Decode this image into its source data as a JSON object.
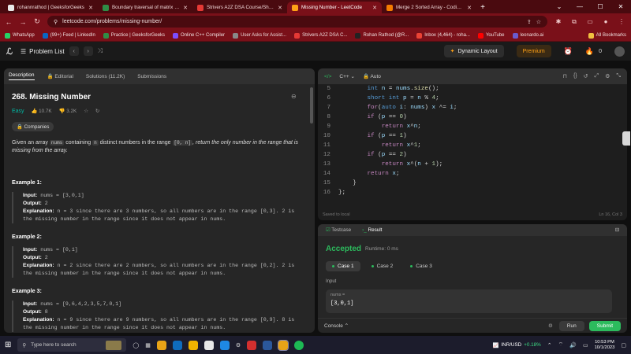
{
  "browser": {
    "tabs": [
      {
        "title": "rohannrathod | GeeksforGeeks",
        "favicon_color": "#e8e8e8",
        "active": false
      },
      {
        "title": "Boundary traversal of matrix | Pr",
        "favicon_color": "#2f8d46",
        "active": false
      },
      {
        "title": "Strivers A2Z DSA Course/Sheet",
        "favicon_color": "#e53935",
        "active": false
      },
      {
        "title": "Missing Number - LeetCode",
        "favicon_color": "#ffa116",
        "active": true
      },
      {
        "title": "Merge 2 Sorted Array - Coding N",
        "favicon_color": "#f57c00",
        "active": false
      }
    ],
    "new_tab": "+",
    "url": "leetcode.com/problems/missing-number/",
    "bookmarks": [
      {
        "label": "WhatsApp",
        "color": "#25d366"
      },
      {
        "label": "(99+) Feed | LinkedIn",
        "color": "#0a66c2"
      },
      {
        "label": "Practice | GeeksforGeeks",
        "color": "#2f8d46"
      },
      {
        "label": "Online C++ Compiler",
        "color": "#7c4dff"
      },
      {
        "label": "User Asks for Assist...",
        "color": "#888888"
      },
      {
        "label": "Strivers A2Z DSA C...",
        "color": "#e53935"
      },
      {
        "label": "Rohan Rathod (@R...",
        "color": "#222222"
      },
      {
        "label": "Inbox (4,464) - roha...",
        "color": "#ea4335"
      },
      {
        "label": "YouTube",
        "color": "#ff0000"
      },
      {
        "label": "leonardo.ai",
        "color": "#6a5acd"
      }
    ],
    "all_bookmarks": "All Bookmarks"
  },
  "lc_nav": {
    "problem_list": "Problem List",
    "dynamic_layout": "Dynamic Layout",
    "premium": "Premium",
    "streak": "0"
  },
  "left_panel": {
    "tabs": [
      "Description",
      "Editorial",
      "Solutions (11.2K)",
      "Submissions"
    ],
    "title": "268. Missing Number",
    "difficulty": "Easy",
    "likes": "10.7K",
    "dislikes": "3.2K",
    "companies": "Companies",
    "desc_1": "Given an array",
    "desc_code_1": "nums",
    "desc_2": "containing",
    "desc_code_2": "n",
    "desc_3": "distinct numbers in the range",
    "desc_code_3": "[0, n]",
    "desc_4": ", return the only number in the range that is missing from the array.",
    "examples": [
      {
        "heading": "Example 1:",
        "input_label": "Input:",
        "input": " nums = [3,0,1]",
        "output_label": "Output:",
        "output": " 2",
        "expl_label": "Explanation:",
        "explanation": " n = 3 since there are 3 numbers, so all numbers are in the range [0,3]. 2 is the missing number in the range since it does not appear in nums."
      },
      {
        "heading": "Example 2:",
        "input_label": "Input:",
        "input": " nums = [0,1]",
        "output_label": "Output:",
        "output": " 2",
        "expl_label": "Explanation:",
        "explanation": " n = 2 since there are 2 numbers, so all numbers are in the range [0,2]. 2 is the missing number in the range since it does not appear in nums."
      },
      {
        "heading": "Example 3:",
        "input_label": "Input:",
        "input": " nums = [9,6,4,2,3,5,7,0,1]",
        "output_label": "Output:",
        "output": " 8",
        "expl_label": "Explanation:",
        "explanation": " n = 9 since there are 9 numbers, so all numbers are in the range [0,9]. 8 is the missing number in the range since it does not appear in nums."
      }
    ]
  },
  "editor": {
    "language": "C++",
    "mode": "Auto",
    "lines": [
      {
        "n": "5",
        "indent": "        ",
        "tokens": [
          [
            "ty",
            "int "
          ],
          [
            "ct",
            "n"
          ],
          [
            "pl",
            " = "
          ],
          [
            "ct",
            "nums"
          ],
          [
            "pl",
            "."
          ],
          [
            "fn",
            "size"
          ],
          [
            "pl",
            "();"
          ]
        ]
      },
      {
        "n": "6",
        "indent": "        ",
        "tokens": [
          [
            "ty",
            "short int "
          ],
          [
            "ct",
            "p"
          ],
          [
            "pl",
            " = "
          ],
          [
            "ct",
            "n"
          ],
          [
            "pl",
            " % "
          ],
          [
            "nm",
            "4"
          ],
          [
            "pl",
            ";"
          ]
        ]
      },
      {
        "n": "7",
        "indent": "        ",
        "tokens": [
          [
            "kw",
            "for"
          ],
          [
            "pl",
            "("
          ],
          [
            "ty",
            "auto "
          ],
          [
            "ct",
            "i"
          ],
          [
            "pl",
            ": "
          ],
          [
            "ct",
            "nums"
          ],
          [
            "pl",
            ") "
          ],
          [
            "ct",
            "x"
          ],
          [
            "pl",
            " ^= "
          ],
          [
            "ct",
            "i"
          ],
          [
            "pl",
            ";"
          ]
        ]
      },
      {
        "n": "8",
        "indent": "        ",
        "tokens": [
          [
            "kw",
            "if"
          ],
          [
            "pl",
            " ("
          ],
          [
            "ct",
            "p"
          ],
          [
            "pl",
            " == "
          ],
          [
            "nm",
            "0"
          ],
          [
            "pl",
            ")"
          ]
        ]
      },
      {
        "n": "9",
        "indent": "            ",
        "tokens": [
          [
            "kw",
            "return "
          ],
          [
            "ct",
            "x"
          ],
          [
            "pl",
            "^"
          ],
          [
            "ct",
            "n"
          ],
          [
            "pl",
            ";"
          ]
        ]
      },
      {
        "n": "10",
        "indent": "        ",
        "tokens": [
          [
            "kw",
            "if"
          ],
          [
            "pl",
            " ("
          ],
          [
            "ct",
            "p"
          ],
          [
            "pl",
            " == "
          ],
          [
            "nm",
            "1"
          ],
          [
            "pl",
            ")"
          ]
        ]
      },
      {
        "n": "11",
        "indent": "            ",
        "tokens": [
          [
            "kw",
            "return "
          ],
          [
            "ct",
            "x"
          ],
          [
            "pl",
            "^"
          ],
          [
            "nm",
            "1"
          ],
          [
            "pl",
            ";"
          ]
        ]
      },
      {
        "n": "12",
        "indent": "        ",
        "tokens": [
          [
            "kw",
            "if"
          ],
          [
            "pl",
            " ("
          ],
          [
            "ct",
            "p"
          ],
          [
            "pl",
            " == "
          ],
          [
            "nm",
            "2"
          ],
          [
            "pl",
            ")"
          ]
        ]
      },
      {
        "n": "13",
        "indent": "            ",
        "tokens": [
          [
            "kw",
            "return "
          ],
          [
            "ct",
            "x"
          ],
          [
            "pl",
            "^("
          ],
          [
            "ct",
            "n"
          ],
          [
            "pl",
            " + "
          ],
          [
            "nm",
            "1"
          ],
          [
            "pl",
            ");"
          ]
        ]
      },
      {
        "n": "14",
        "indent": "        ",
        "tokens": [
          [
            "kw",
            "return "
          ],
          [
            "ct",
            "x"
          ],
          [
            "pl",
            ";"
          ]
        ]
      },
      {
        "n": "15",
        "indent": "    ",
        "tokens": [
          [
            "pl",
            "}"
          ]
        ]
      },
      {
        "n": "16",
        "indent": "",
        "tokens": [
          [
            "pl",
            "};"
          ]
        ]
      }
    ],
    "saved": "Saved to local",
    "cursor": "Ln 16, Col 3"
  },
  "test_panel": {
    "tabs": [
      "Testcase",
      "Result"
    ],
    "status": "Accepted",
    "runtime": "Runtime: 0 ms",
    "cases": [
      "Case 1",
      "Case 2",
      "Case 3"
    ],
    "input_label": "Input",
    "input_name": "nums =",
    "input_value": "[3,0,1]",
    "console": "Console",
    "run": "Run",
    "submit": "Submit"
  },
  "taskbar": {
    "search_placeholder": "Type here to search",
    "ticker_name": "INR/USD",
    "ticker_change": "+0.18%",
    "time": "10:53 PM",
    "date": "10/1/2023"
  }
}
